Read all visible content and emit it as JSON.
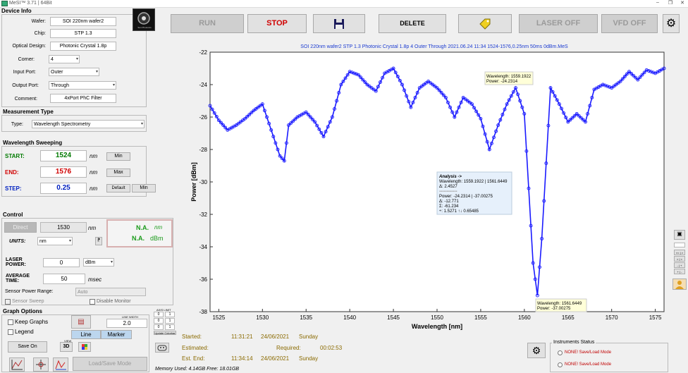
{
  "window": {
    "title": "MeSI™ 3.71 | 64Bit"
  },
  "device": {
    "title": "Device Info",
    "wafer_label": "Wafer:",
    "wafer": "SOI 220nm wafer2",
    "chip_label": "Chip:",
    "chip": "STP 1.3",
    "design_label": "Optical Design:",
    "design": "Photonic Crystal 1.8p",
    "corner_label": "Corner:",
    "corner": "4",
    "input_label": "Input Port:",
    "input": "Outer",
    "output_label": "Output Port:",
    "output": "Through",
    "comment_label": "Comment:",
    "comment": "4xPort PhC Filter"
  },
  "logo": {
    "text": "Sun Photonics"
  },
  "meas": {
    "title": "Measurement Type",
    "type_label": "Type:",
    "type": "Wavelength Spectrometry"
  },
  "sweep": {
    "title": "Wavelength Sweeping",
    "start_label": "START:",
    "start": "1524",
    "end_label": "END:",
    "end": "1576",
    "step_label": "STEP:",
    "step": "0.25",
    "unit": "nm",
    "min_btn": "Min",
    "max_btn": "Max",
    "default_btn": "Default",
    "min2_btn": "Min"
  },
  "control": {
    "title": "Control",
    "direct_btn": "Direct",
    "direct_val": "1530",
    "direct_unit": "nm",
    "na1": "N.A.",
    "na1_unit": "nm",
    "na2": "N.A.",
    "na2_unit": "dBm",
    "units_label": "UNITS:",
    "units": "nm",
    "laser_label": "LASER POWER:",
    "laser_val": "0",
    "laser_unit": "dBm",
    "avg_label": "AVERAGE TIME:",
    "avg_val": "50",
    "avg_unit": "msec",
    "range_label": "Sensor Power Range:",
    "range_val": "Auto",
    "sweep_chk": "Sensor Sweep",
    "monitor_chk": "Disable Monitor"
  },
  "graph": {
    "title": "Graph Options",
    "keep": "Keep Graphs",
    "legend": "Legend",
    "line_width_label": "LINE WIDTH",
    "line_width": "2.0",
    "line_btn": "Line",
    "marker_btn": "Marker",
    "save_on": "Save On",
    "view_label": "VIEW",
    "view_3d": "3D",
    "load_save": "Load/Save Mode",
    "axis_limit": "AXIS LIMIT",
    "axis_vals": [
      "0",
      "1",
      "0",
      "1",
      "0",
      "1"
    ],
    "update_btn": "Update Colorbar"
  },
  "memory": "Memory Used: 4.14GB  Free: 18.01GB",
  "toolbar": {
    "run": "RUN",
    "stop": "STOP",
    "delete": "DELETE",
    "laser_off": "LASER OFF",
    "vfd_off": "VFD OFF"
  },
  "timing": {
    "started_label": "Started:",
    "started_time": "11:31:21",
    "started_date": "24/06/2021",
    "started_day": "Sunday",
    "estimated_label": "Estimated:",
    "required_label": "Required:",
    "required": "00:02:53",
    "end_label": "Est. End:",
    "end_time": "11:34:14",
    "end_date": "24/06/2021",
    "end_day": "Sunday"
  },
  "instruments": {
    "title": "Instruments Status",
    "items": [
      "NONE! Save/Load Mode",
      "NONE! Save/Load Mode"
    ]
  },
  "side_nav": [
    "<< | >",
    "> | <",
    "- | +",
    "+ | -"
  ],
  "chart_data": {
    "type": "line",
    "title": "SOI 220nm wafer2 STP 1.3 Photonic Crystal 1.8p 4 Outer Through 2021.06.24 11:34 1524-1576,0.25nm 50ms 0dBm.MeS",
    "xlabel": "Wavelength [nm]",
    "ylabel": "Power [dBm]",
    "xlim": [
      1524,
      1576
    ],
    "ylim": [
      -38,
      -22
    ],
    "xticks": [
      1525,
      1530,
      1535,
      1540,
      1545,
      1550,
      1555,
      1560,
      1565,
      1570,
      1575
    ],
    "yticks": [
      -22,
      -24,
      -26,
      -28,
      -30,
      -32,
      -34,
      -36,
      -38
    ],
    "color": "#1a1aff",
    "x": [
      1524,
      1525,
      1526,
      1527,
      1528,
      1529,
      1530,
      1531,
      1532,
      1532.5,
      1533,
      1534,
      1535,
      1536,
      1537,
      1538,
      1539,
      1540,
      1541,
      1542,
      1543,
      1544,
      1545,
      1546,
      1547,
      1548,
      1549,
      1550,
      1551,
      1552,
      1553,
      1554,
      1555,
      1556,
      1557,
      1558,
      1559,
      1560,
      1561,
      1561.5,
      1562,
      1563,
      1564,
      1565,
      1566,
      1567,
      1568,
      1569,
      1570,
      1571,
      1572,
      1573,
      1574,
      1575,
      1576
    ],
    "y": [
      -25.3,
      -26.2,
      -26.8,
      -26.5,
      -26.1,
      -25.6,
      -25.2,
      -26.8,
      -28.4,
      -28.7,
      -26.5,
      -26.0,
      -25.7,
      -26.3,
      -27.2,
      -26.0,
      -24.0,
      -23.2,
      -23.4,
      -24.0,
      -24.4,
      -23.3,
      -23.0,
      -24.0,
      -25.4,
      -24.2,
      -23.8,
      -24.2,
      -24.8,
      -26.0,
      -24.8,
      -25.2,
      -26.1,
      -28.0,
      -26.5,
      -25.2,
      -24.2,
      -25.8,
      -35.0,
      -37.0,
      -33.5,
      -24.2,
      -25.2,
      -26.3,
      -25.8,
      -26.3,
      -24.3,
      -24.0,
      -24.2,
      -23.8,
      -23.2,
      -23.7,
      -23.1,
      -23.3,
      -23.0
    ],
    "annotations": [
      {
        "lines": [
          "Wavelength: 1559.1922",
          "Power: -24.2314"
        ]
      },
      {
        "lines": [
          "Wavelength: 1561.6449",
          "Power: -37.00275"
        ]
      },
      {
        "lines": [
          "Analysis ->",
          "Wavelength: 1559.1922 | 1561.6449",
          "Δ: 2.4527",
          "Power: -24.2314 | -37.00275",
          "Δ: -12.771",
          "Σ: -61.234",
          "÷: 1.5271 ↑↓ 0.65485"
        ]
      }
    ]
  }
}
